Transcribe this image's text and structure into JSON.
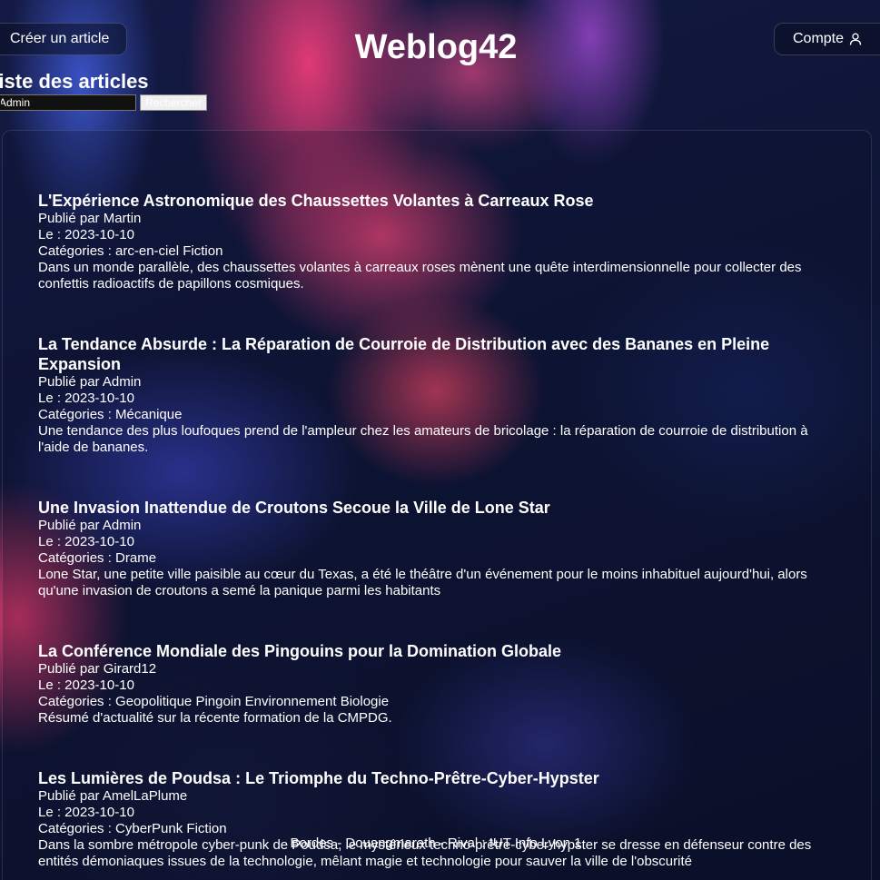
{
  "header": {
    "create_label": "Créer un article",
    "site_title": "Weblog42",
    "account_label": "Compte",
    "account_icon": "user-icon"
  },
  "page": {
    "title": "Liste des articles"
  },
  "search": {
    "value": "Admin",
    "button_label": "Rechercher"
  },
  "articles": [
    {
      "title": "L'Expérience Astronomique des Chaussettes Volantes à Carreaux Rose",
      "author": "Publié par Martin",
      "date": "Le : 2023-10-10",
      "categories": "Catégories : arc-en-ciel Fiction",
      "summary": "Dans un monde parallèle, des chaussettes volantes à carreaux roses mènent une quête interdimensionnelle pour collecter des confettis radioactifs de papillons cosmiques."
    },
    {
      "title": "La Tendance Absurde : La Réparation de Courroie de Distribution avec des Bananes en Pleine Expansion",
      "author": "Publié par Admin",
      "date": "Le : 2023-10-10",
      "categories": "Catégories : Mécanique",
      "summary": "Une tendance des plus loufoques prend de l'ampleur chez les amateurs de bricolage : la réparation de courroie de distribution à l'aide de bananes."
    },
    {
      "title": "Une Invasion Inattendue de Croutons Secoue la Ville de Lone Star",
      "author": "Publié par Admin",
      "date": "Le : 2023-10-10",
      "categories": "Catégories : Drame",
      "summary": "Lone Star, une petite ville paisible au cœur du Texas, a été le théâtre d'un événement pour le moins inhabituel aujourd'hui, alors qu'une invasion de croutons a semé la panique parmi les habitants"
    },
    {
      "title": "La Conférence Mondiale des Pingouins pour la Domination Globale",
      "author": "Publié par Girard12",
      "date": "Le : 2023-10-10",
      "categories": "Catégories : Geopolitique Pingoin Environnement Biologie",
      "summary": "Résumé d'actualité sur la récente formation de la CMPDG."
    },
    {
      "title": "Les Lumières de Poudsa : Le Triomphe du Techno-Prêtre-Cyber-Hypster",
      "author": "Publié par AmelLaPlume",
      "date": "Le : 2023-10-10",
      "categories": "Catégories : CyberPunk Fiction",
      "summary": "Dans la sombre métropole cyber-punk de Poudsa, le mystérieux techno-prêtre-cyber-hypster se dresse en défenseur contre des entités démoniaques issues de la technologie, mêlant magie et technologie pour sauver la ville de l'obscurité"
    }
  ],
  "footer": {
    "text": "Bordes - Douangmarath - Rival : IUT Info Lyon 1"
  }
}
